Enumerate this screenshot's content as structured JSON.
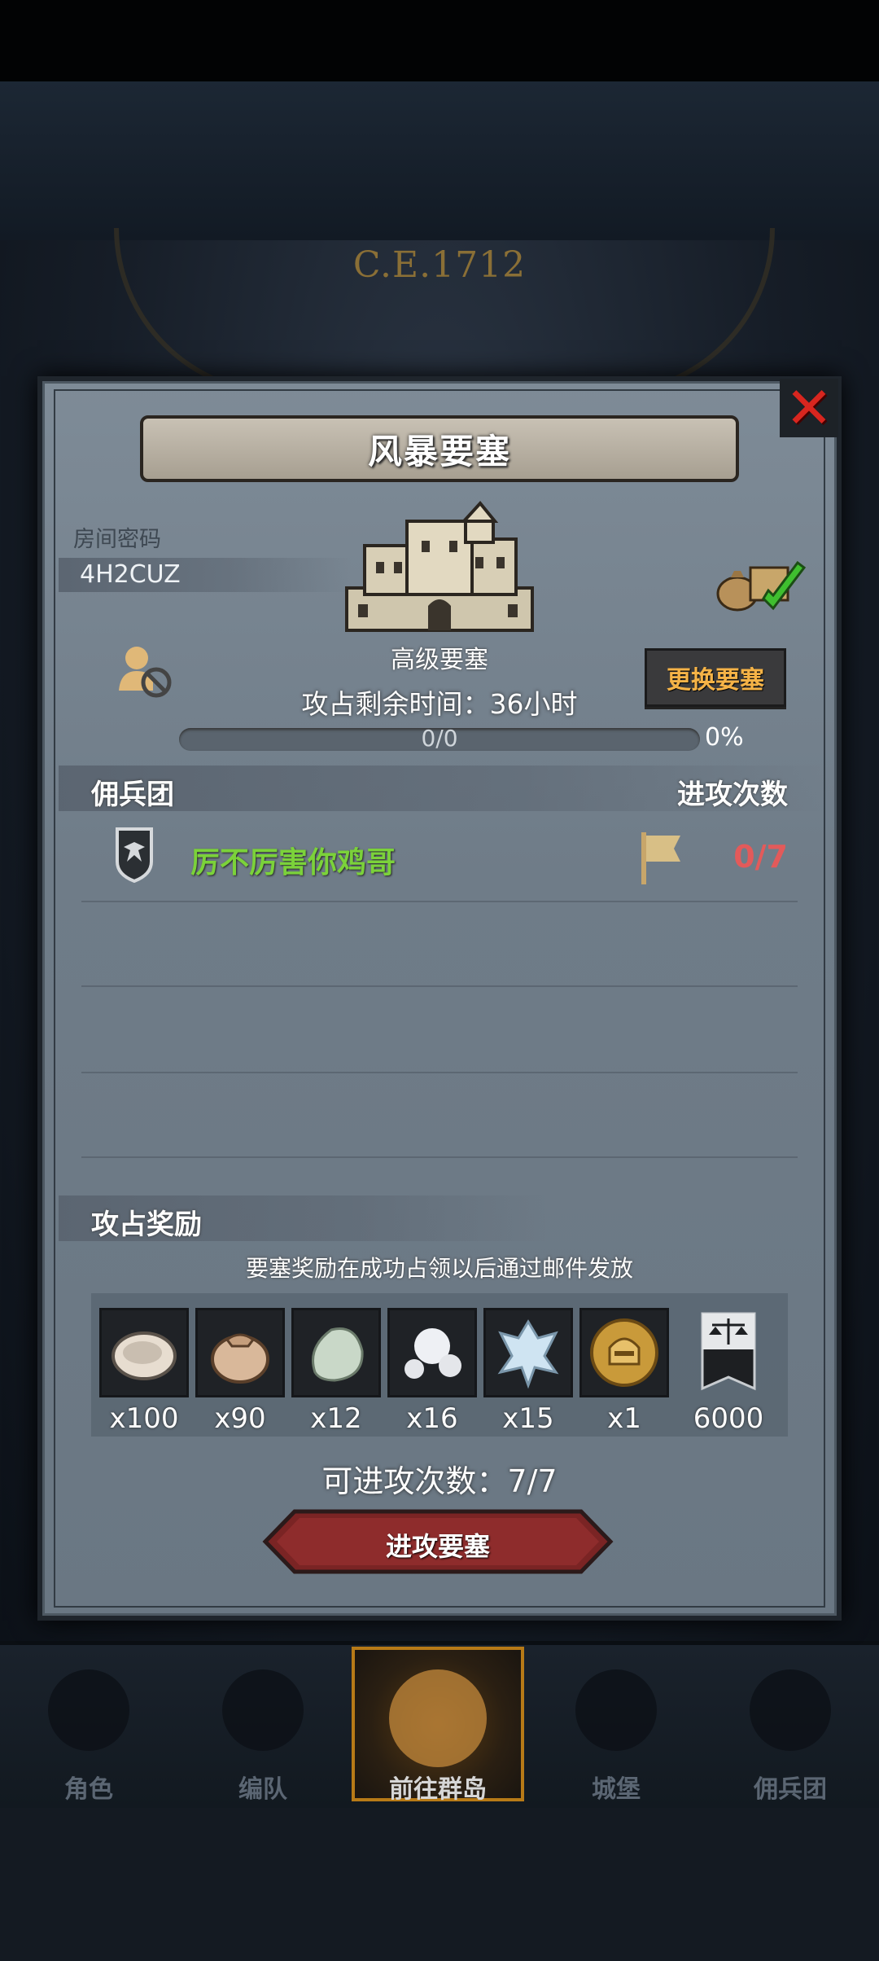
{
  "background": {
    "era": "C.E.1712"
  },
  "dialog": {
    "title": "风暴要塞",
    "room_label": "房间密码",
    "room_code": "4H2CUZ",
    "fortress_name": "高级要塞",
    "change_button": "更换要塞",
    "timer_text": "攻占剩余时间：36小时",
    "progress": {
      "text": "0/0",
      "percent_text": "0%",
      "fraction": 0
    },
    "mercenary_header": "佣兵团",
    "attack_count_header": "进攻次数",
    "guilds": [
      {
        "name": "厉不厉害你鸡哥",
        "attacks": "0/7"
      }
    ],
    "rewards_header": "攻占奖励",
    "rewards_note": "要塞奖励在成功占领以后通过邮件发放",
    "rewards": [
      {
        "icon": "oyster-icon",
        "qty": "x100"
      },
      {
        "icon": "sack-icon",
        "qty": "x90"
      },
      {
        "icon": "pale-stone-icon",
        "qty": "x12"
      },
      {
        "icon": "pearls-icon",
        "qty": "x16"
      },
      {
        "icon": "crystal-icon",
        "qty": "x15"
      },
      {
        "icon": "gold-helmet-coin-icon",
        "qty": "x1"
      },
      {
        "icon": "justice-banner-icon",
        "qty": "6000"
      }
    ],
    "attempts_text": "可进攻次数：7/7",
    "attack_button": "进攻要塞"
  },
  "nav": [
    {
      "label": "角色"
    },
    {
      "label": "编队"
    },
    {
      "label": "前往群岛",
      "active": true
    },
    {
      "label": "城堡"
    },
    {
      "label": "佣兵团"
    }
  ],
  "colors": {
    "accent_orange": "#f5b347",
    "guild_green": "#7bd23a",
    "count_red": "#e35a5a",
    "nav_active_border": "#b77a17"
  }
}
